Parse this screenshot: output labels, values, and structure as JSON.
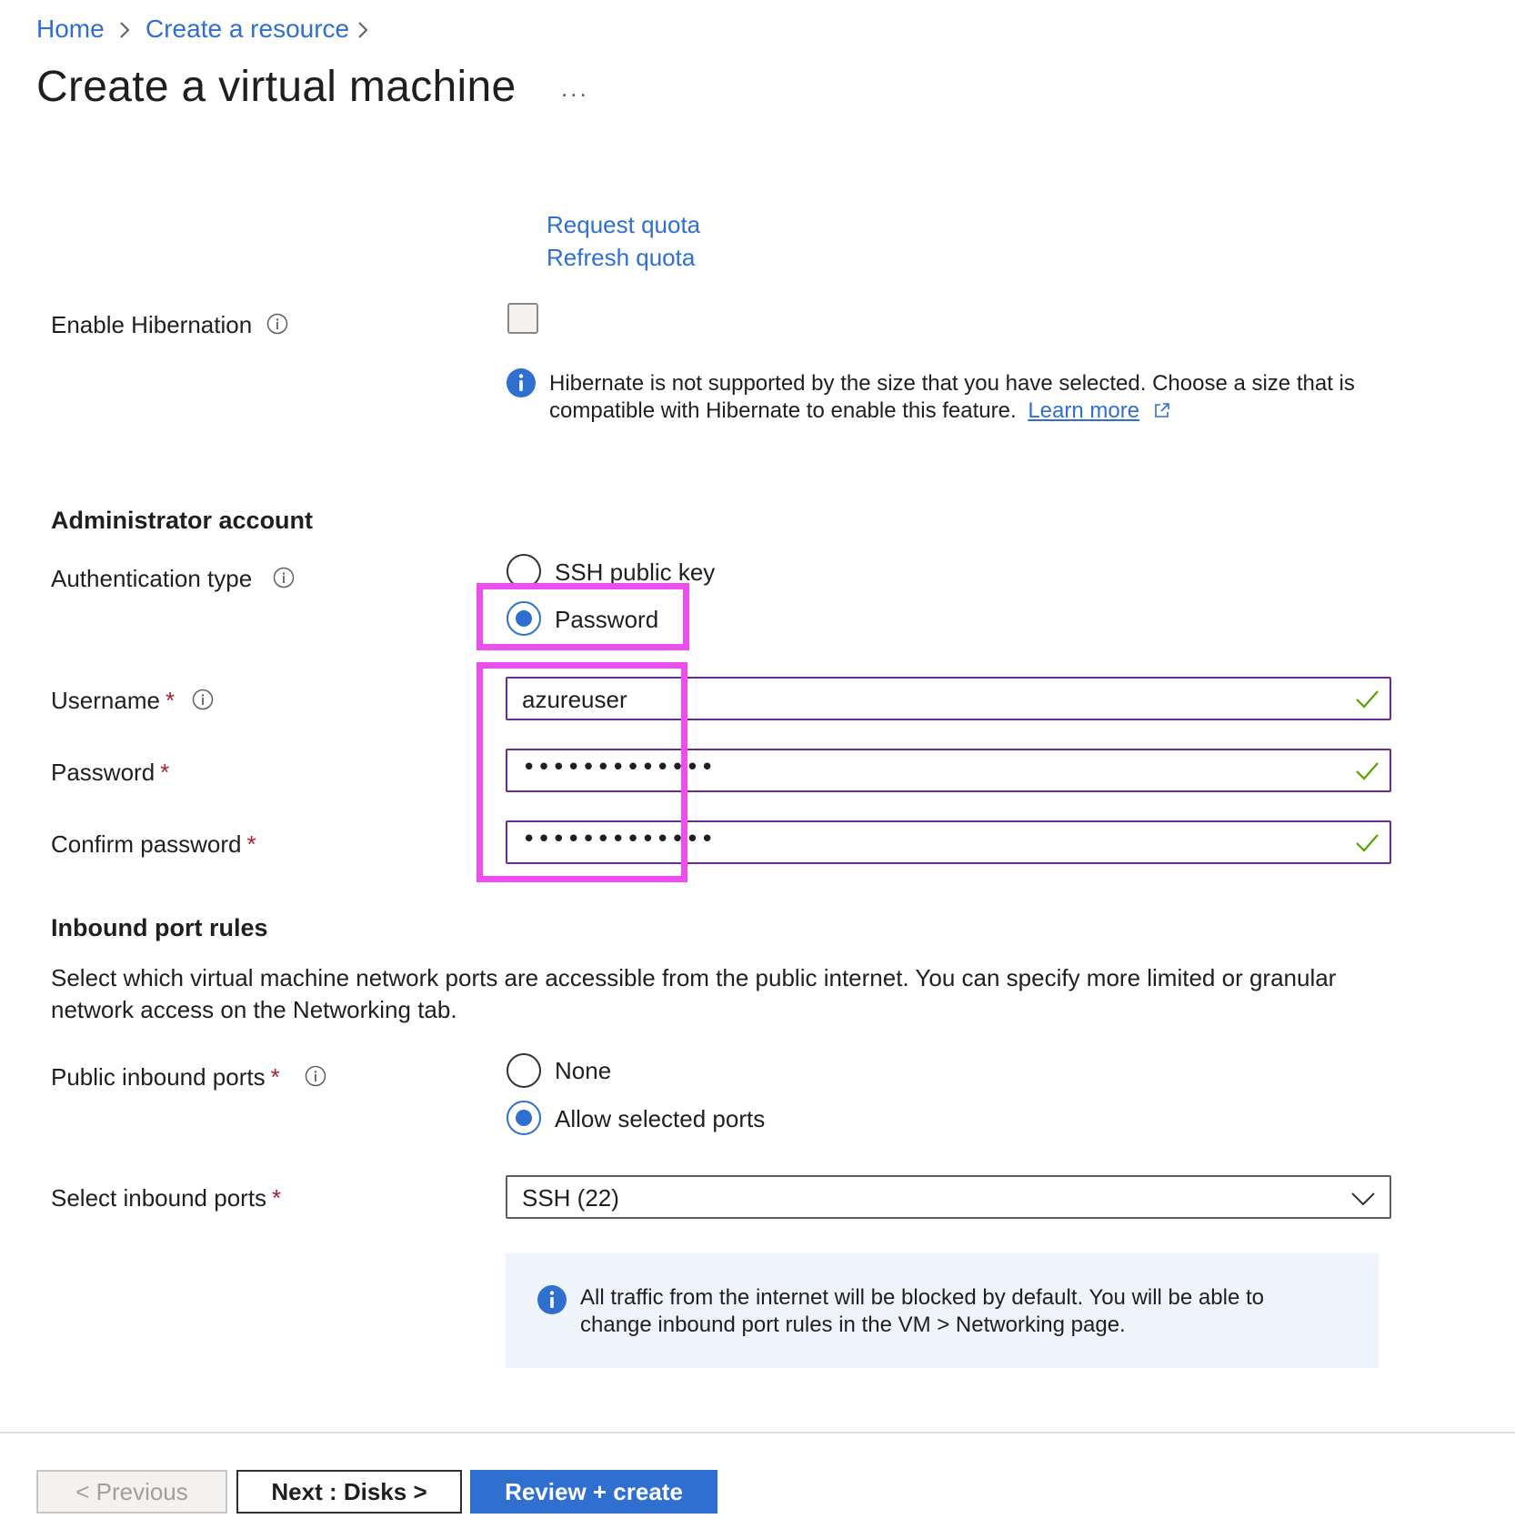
{
  "breadcrumb": {
    "home": "Home",
    "create_resource": "Create a resource"
  },
  "page": {
    "title": "Create a virtual machine",
    "more": "..."
  },
  "quota": {
    "request": "Request quota",
    "refresh": "Refresh quota"
  },
  "hibernation": {
    "label": "Enable Hibernation",
    "checked": false,
    "message_text": "Hibernate is not supported by the size that you have selected. Choose a size that is compatible with Hibernate to enable this feature.",
    "learn_more": "Learn more"
  },
  "admin": {
    "heading": "Administrator account",
    "auth_label": "Authentication type",
    "auth_options": [
      "SSH public key",
      "Password"
    ],
    "auth_selected": "Password",
    "username_label": "Username",
    "username_value": "azureuser",
    "password_label": "Password",
    "password_value": "•••••••••••••",
    "confirm_label": "Confirm password",
    "confirm_value": "•••••••••••••",
    "required_mark": "*"
  },
  "inbound": {
    "heading": "Inbound port rules",
    "description": "Select which virtual machine network ports are accessible from the public internet. You can specify more limited or granular network access on the Networking tab.",
    "public_label": "Public inbound ports",
    "public_options": [
      "None",
      "Allow selected ports"
    ],
    "public_selected": "Allow selected ports",
    "select_label": "Select inbound ports",
    "select_value": "SSH (22)",
    "banner_text": "All traffic from the internet will be blocked by default. You will be able to change inbound port rules in the VM > Networking page."
  },
  "footer": {
    "previous": "< Previous",
    "next": "Next : Disks >",
    "review": "Review + create"
  },
  "colors": {
    "link": "#2f6fcf",
    "highlight": "#ec4ef0",
    "valid_check": "#57a300",
    "input_border": "#6b2c91",
    "primary_button": "#2f6fcf"
  }
}
